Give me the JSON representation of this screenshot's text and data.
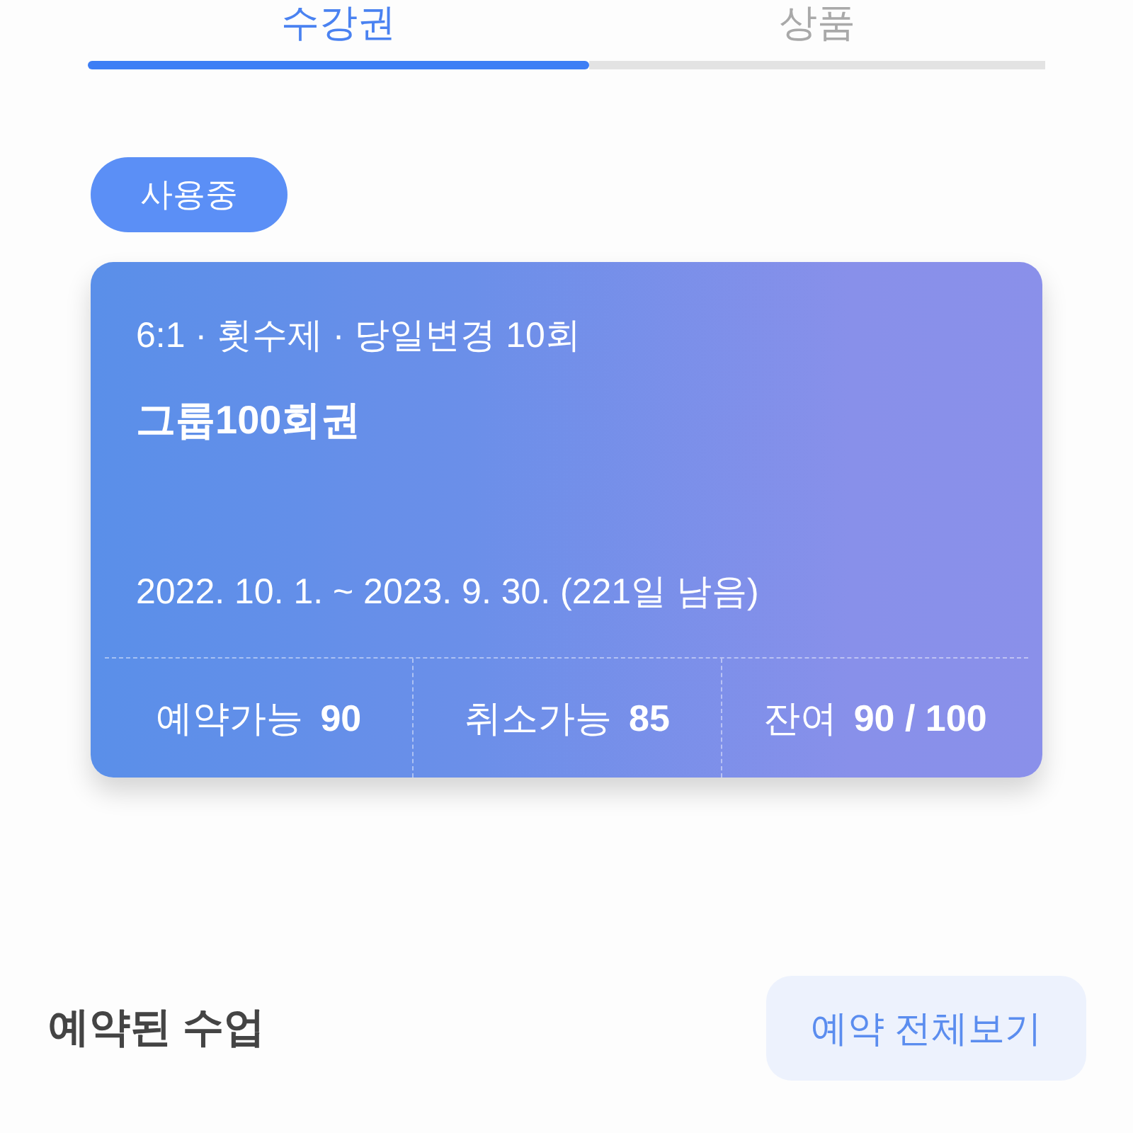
{
  "tabs": [
    {
      "label": "수강권",
      "selected": true
    },
    {
      "label": "상품",
      "selected": false
    }
  ],
  "pass": {
    "status": "사용중",
    "subtitle": "6:1 · 횟수제 · 당일변경 10회",
    "title": "그룹100회권",
    "period": "2022. 10. 1. ~ 2023. 9. 30. (221일 남음)",
    "stats": [
      {
        "label": "예약가능",
        "value": "90"
      },
      {
        "label": "취소가능",
        "value": "85"
      },
      {
        "label": "잔여",
        "value": "90 / 100"
      }
    ]
  },
  "reserved_section": {
    "title": "예약된 수업",
    "button": "예약 전체보기"
  }
}
